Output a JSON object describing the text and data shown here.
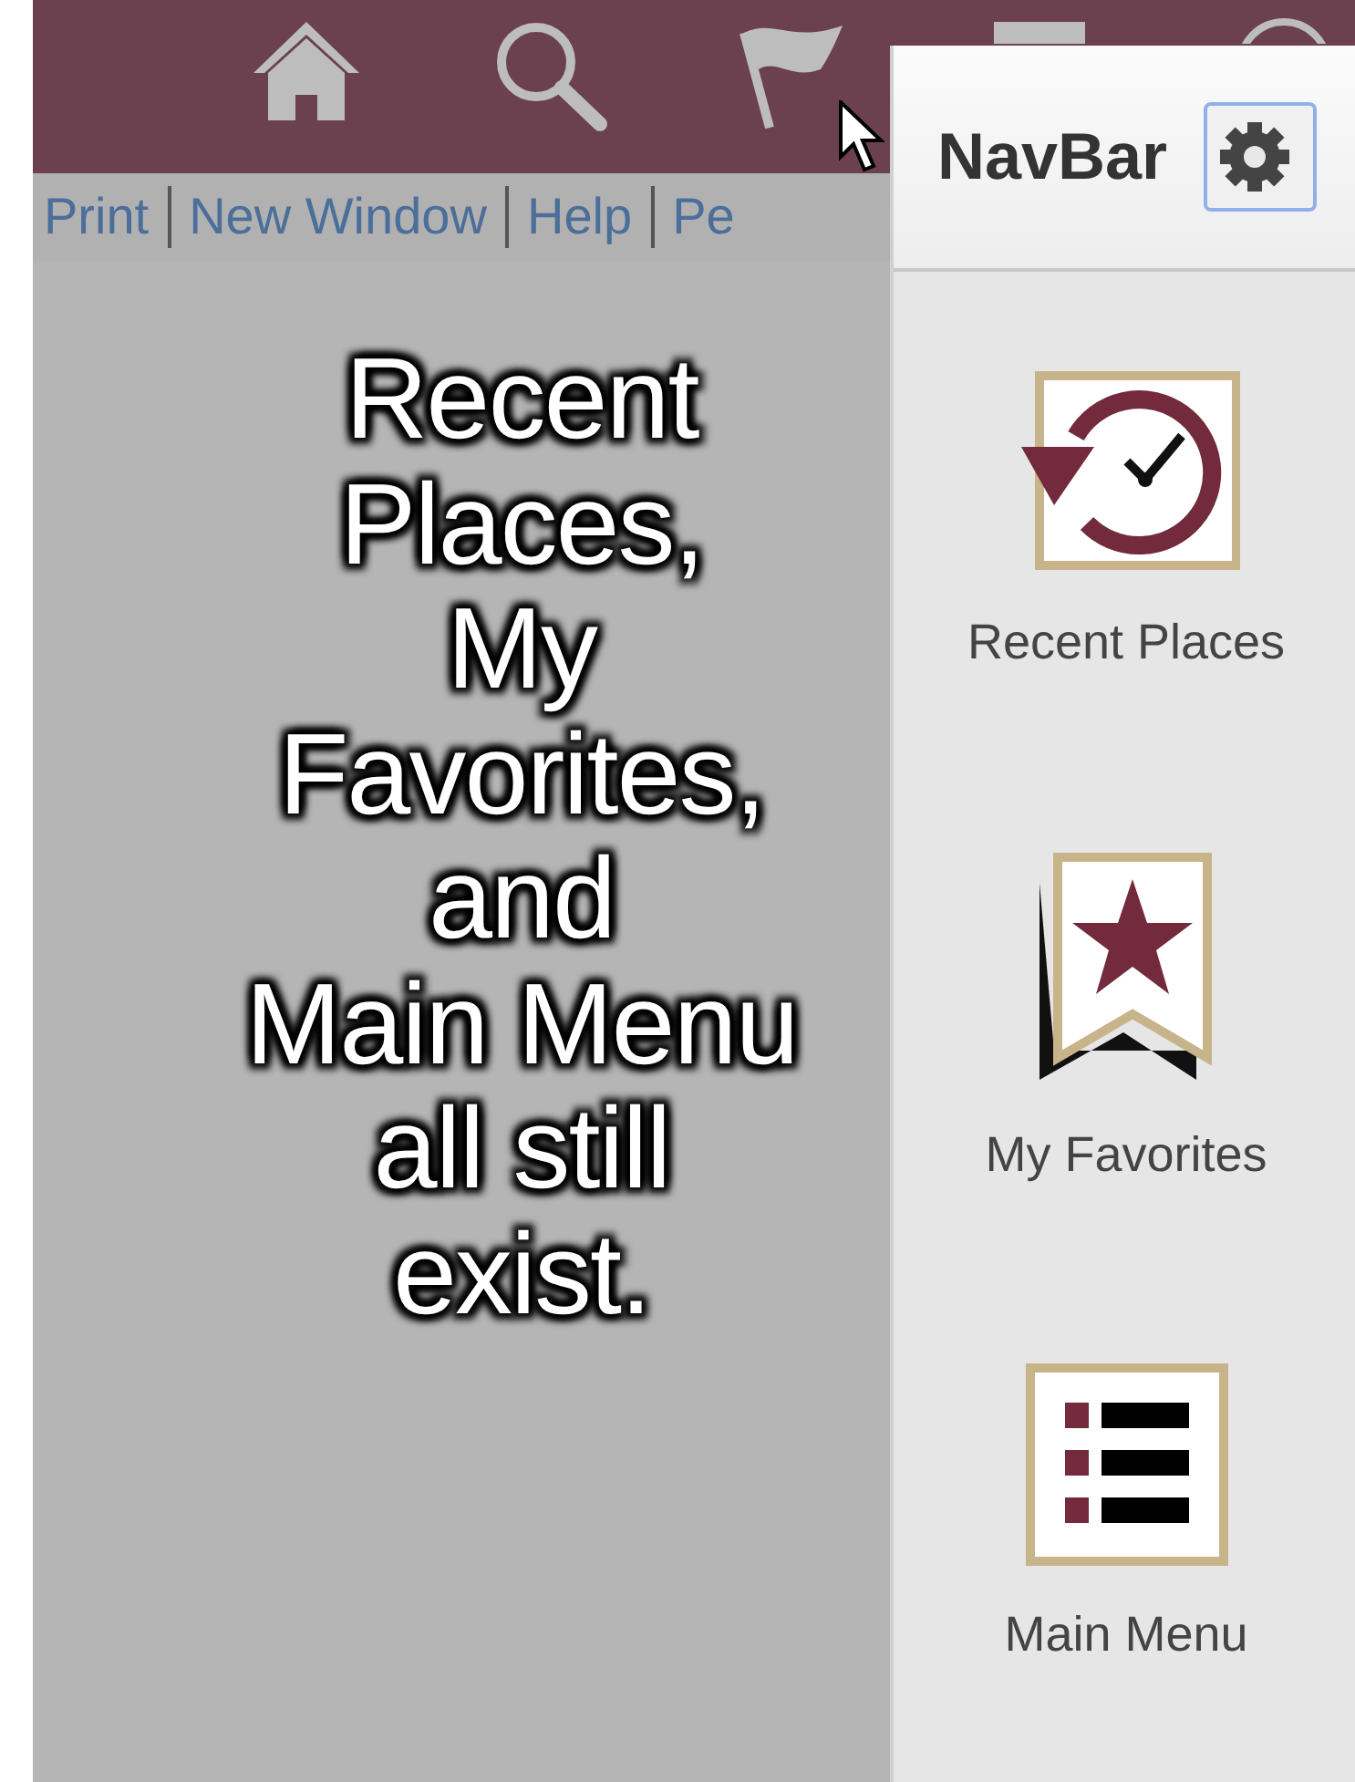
{
  "top_bar": {
    "icons": [
      {
        "kind": "home"
      },
      {
        "kind": "search"
      },
      {
        "kind": "flag"
      },
      {
        "kind": "actions"
      },
      {
        "kind": "circle"
      }
    ]
  },
  "links": [
    "Print",
    "New Window",
    "Help",
    "Pe"
  ],
  "caption": {
    "lines": [
      "Recent",
      "Places,",
      "My",
      "Favorites,",
      "and",
      "Main Menu",
      "all still",
      "exist."
    ]
  },
  "navbar_panel": {
    "title": "NavBar",
    "tiles": [
      {
        "kind": "recent",
        "label": "Recent Places"
      },
      {
        "kind": "favorites",
        "label": "My Favorites"
      },
      {
        "kind": "menu",
        "label": "Main Menu"
      }
    ]
  }
}
